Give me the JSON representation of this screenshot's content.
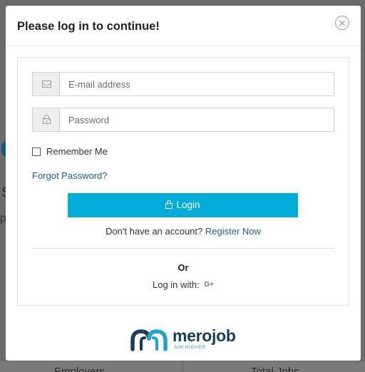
{
  "background": {
    "fragment_e": "e",
    "fragment_s": "s",
    "fragment_p": "p",
    "bottom_left_label": "Employers",
    "bottom_right_label": "Total Jobs"
  },
  "modal": {
    "title": "Please log in to continue!",
    "close_icon": "close-circle-icon"
  },
  "form": {
    "email_placeholder": "E-mail address",
    "email_icon": "envelope-icon",
    "password_placeholder": "Password",
    "password_icon": "lock-icon",
    "remember_label": "Remember Me",
    "remember_checked": false,
    "forgot_label": "Forgot Password?",
    "login_label": "Login",
    "no_account_text": "Don't have an account?",
    "register_label": "Register Now"
  },
  "social": {
    "or_label": "Or",
    "login_with_label": "Log in with:",
    "google_plus_label": "G+"
  },
  "brand": {
    "name": "merojob",
    "tagline": "AIM HIGHER"
  },
  "colors": {
    "primary_button": "#03acd9",
    "link": "#1c5e84",
    "brand_dark": "#173e5c",
    "brand_light": "#1ea2cf"
  }
}
